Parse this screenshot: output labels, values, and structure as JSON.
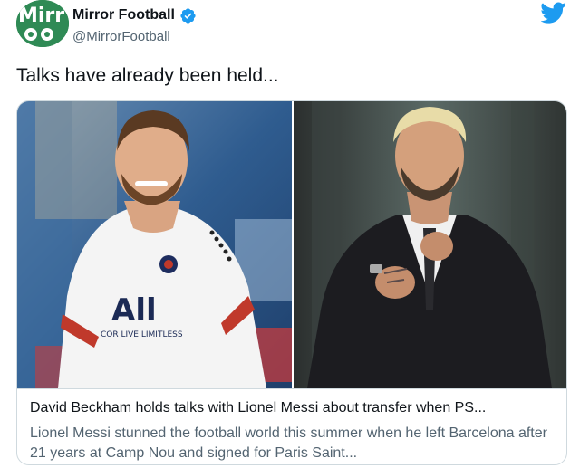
{
  "account": {
    "display_name": "Mirror Football",
    "handle": "@MirrorFootball",
    "avatar_text": "Mirr",
    "avatar_subtext": "o⚽⚽"
  },
  "tweet": {
    "text": "Talks have already been held..."
  },
  "card": {
    "title": "David Beckham holds talks with Lionel Messi about transfer when PS...",
    "description": "Lionel Messi stunned the football world this summer when he left Barcelona after 21 years at Camp Nou and signed for Paris Saint..."
  },
  "images": {
    "left_shirt_text": "All",
    "left_shirt_subtext": "COR LIVE LIMITLESS"
  },
  "colors": {
    "twitter_blue": "#1d9bf0",
    "brand_green": "#2f8a55",
    "text_primary": "#0f1419",
    "text_secondary": "#536471"
  },
  "icons": {
    "verified": "verified-badge-icon",
    "twitter": "twitter-bird-icon"
  }
}
